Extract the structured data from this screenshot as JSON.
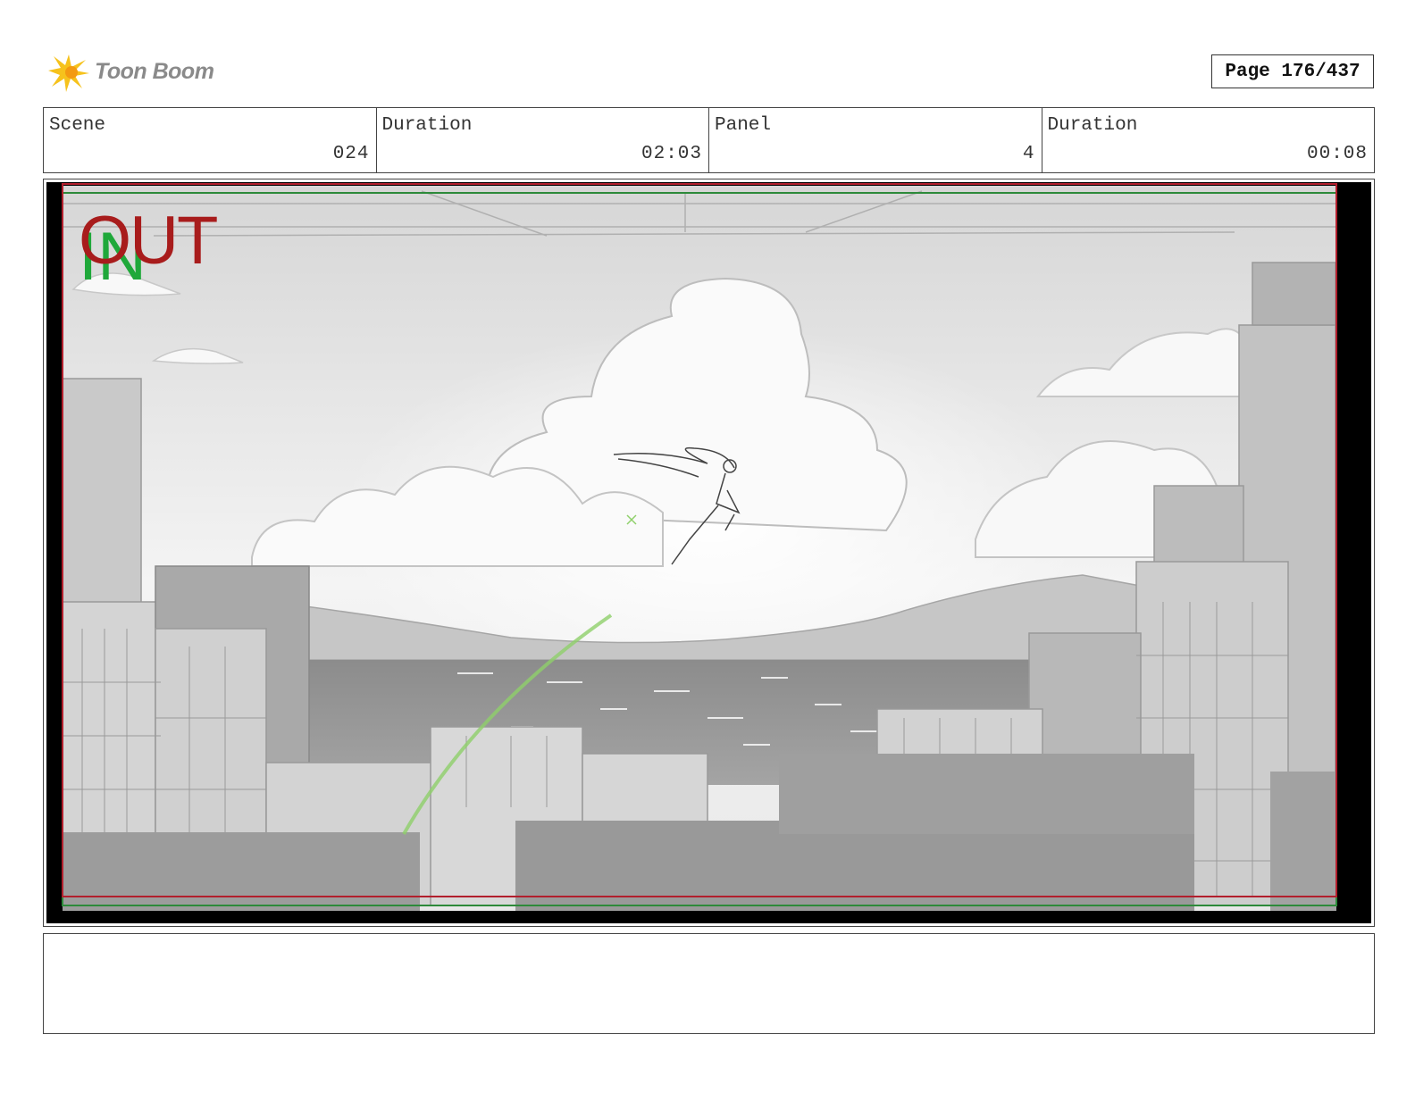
{
  "header": {
    "logo_text": "Toon Boom",
    "page_label": "Page 176/437"
  },
  "info": [
    {
      "label": "Scene",
      "value": "024"
    },
    {
      "label": "Duration",
      "value": "02:03"
    },
    {
      "label": "Panel",
      "value": "4"
    },
    {
      "label": "Duration",
      "value": "00:08"
    }
  ],
  "panel": {
    "in_marker": "IN",
    "out_marker": "OUT",
    "in_color": "#1fa83a",
    "out_color": "#a81c1c"
  },
  "notes": {
    "text": ""
  }
}
